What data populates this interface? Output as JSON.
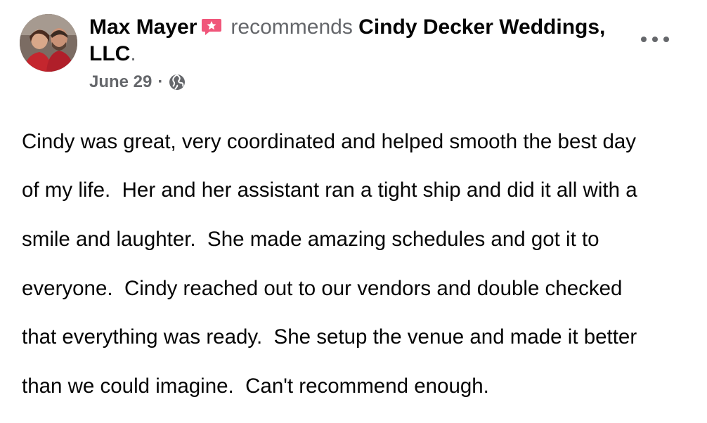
{
  "post": {
    "author": "Max Mayer",
    "verb": "recommends",
    "page_name": "Cindy Decker Weddings, LLC",
    "period": ".",
    "date": "June 29",
    "separator": "·",
    "audience_icon": "globe-icon",
    "options_icon": "more-options-icon",
    "author_badge_icon": "recommendation-badge-icon",
    "body_lines": [
      "Cindy was great, very coordinated and helped smooth the best day",
      "of my life.  Her and her assistant ran a tight ship and did it all with a",
      "smile and laughter.  She made amazing schedules and got it to",
      "everyone.  Cindy reached out to our vendors and double checked",
      "that everything was ready.  She setup the venue and made it better",
      "than we could imagine.  Can't recommend enough."
    ]
  },
  "colors": {
    "badge": "#f0567a",
    "secondary_text": "#65676b",
    "primary_text": "#050505"
  }
}
